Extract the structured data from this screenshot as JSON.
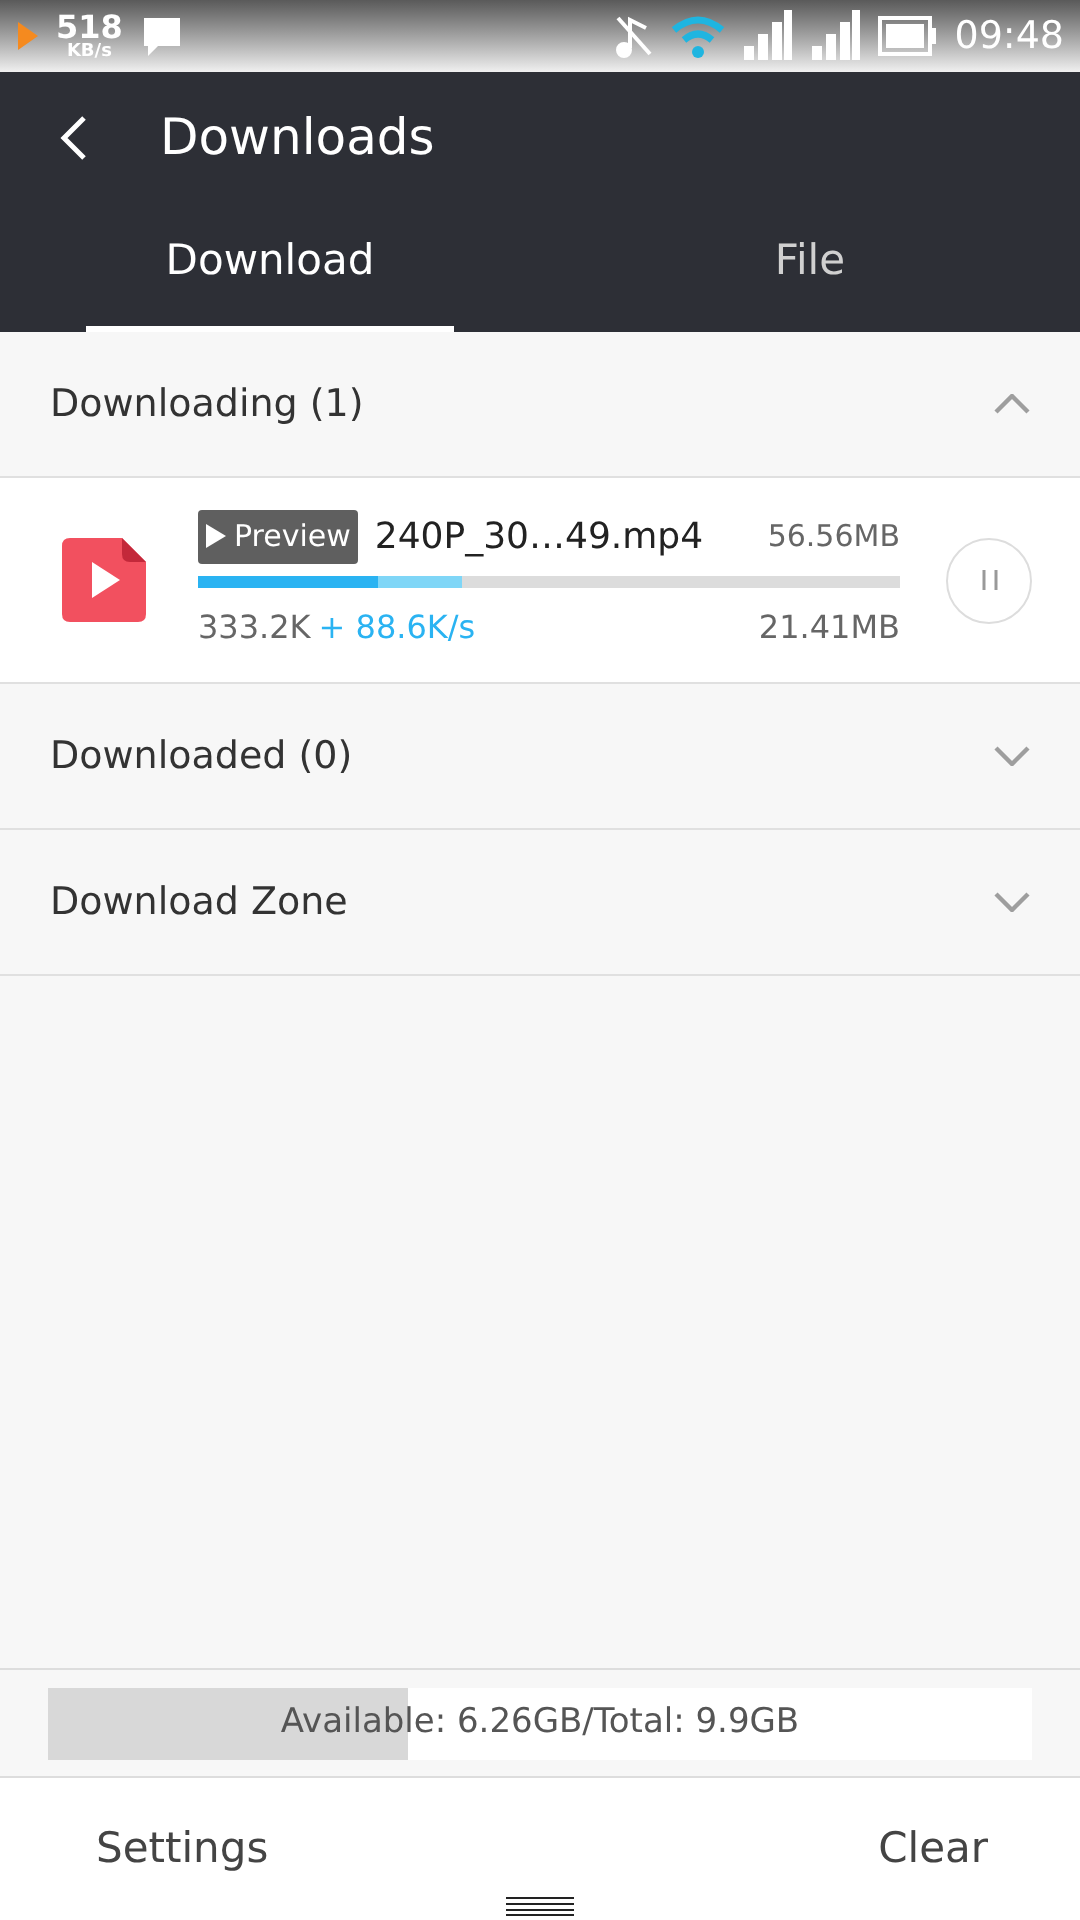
{
  "status_bar": {
    "speed": "518",
    "speed_unit": "KB/s",
    "time": "09:48"
  },
  "header": {
    "title": "Downloads"
  },
  "tabs": [
    {
      "label": "Download",
      "selected": true
    },
    {
      "label": "File",
      "selected": false
    }
  ],
  "sections": [
    {
      "title": "Downloading (1)",
      "expanded": true,
      "items": [
        {
          "badge": "Preview",
          "name": "240P_30…49.mp4",
          "size": "56.56MB",
          "level": 0.256,
          "buffer": {
            "level": 0.376
          },
          "downloaded": "333.2K",
          "speed": "+ 88.6K/s",
          "received": "21.41MB"
        }
      ]
    },
    {
      "title": "Downloaded (0)",
      "expanded": false
    },
    {
      "title": "Download Zone",
      "expanded": false
    }
  ],
  "storage": {
    "text": "Available: 6.26GB/Total: 9.9GB",
    "level": 0.366
  },
  "footer": {
    "left": "Settings",
    "right": "Clear"
  }
}
